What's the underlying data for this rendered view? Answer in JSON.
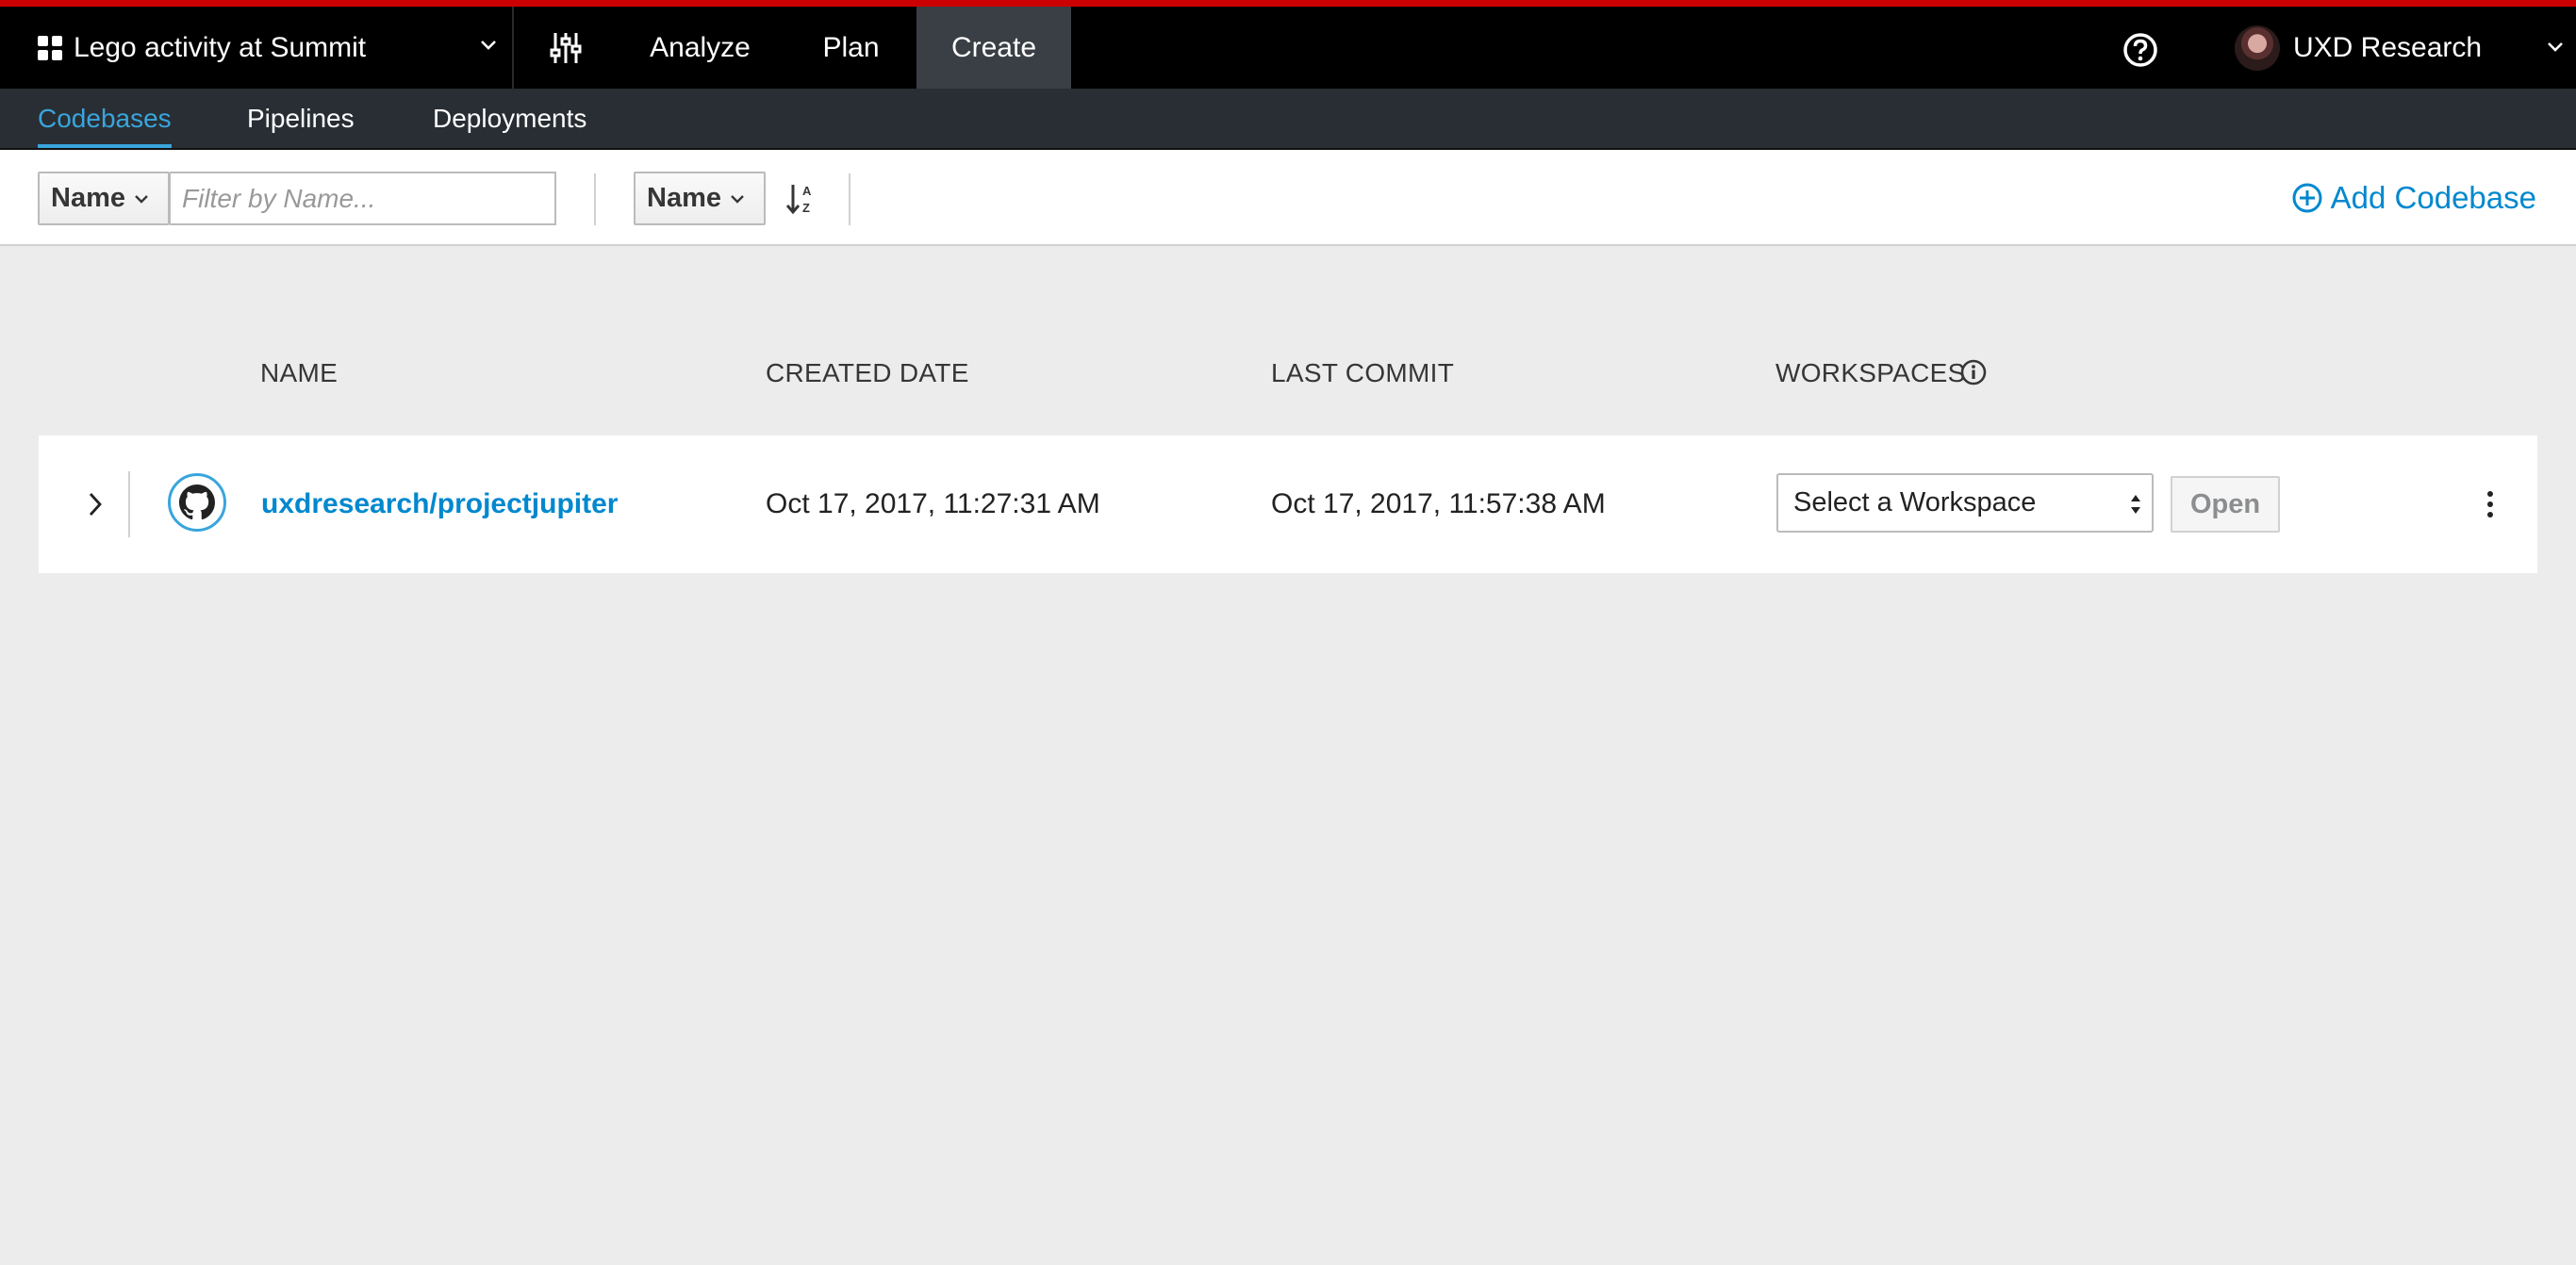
{
  "topbar": {
    "space_name": "Lego activity at Summit",
    "tabs": [
      {
        "label": "Analyze"
      },
      {
        "label": "Plan"
      },
      {
        "label": "Create",
        "active": true
      }
    ],
    "user_name": "UXD Research"
  },
  "subnav": {
    "tabs": [
      {
        "label": "Codebases",
        "active": true
      },
      {
        "label": "Pipelines"
      },
      {
        "label": "Deployments"
      }
    ]
  },
  "toolbar": {
    "filter_field": "Name",
    "filter_placeholder": "Filter by Name...",
    "sort_field": "Name",
    "add_label": "Add Codebase"
  },
  "table": {
    "headers": [
      "NAME",
      "CREATED DATE",
      "LAST COMMIT",
      "WORKSPACES"
    ],
    "rows": [
      {
        "name": "uxdresearch/projectjupiter",
        "created": "Oct 17, 2017, 11:27:31 AM",
        "last_commit": "Oct 17, 2017, 11:57:38 AM",
        "workspace_placeholder": "Select a Workspace",
        "open_label": "Open"
      }
    ]
  },
  "colors": {
    "accent_red": "#cc0000",
    "link_blue": "#0088ce",
    "active_tab_blue": "#39a5dc"
  },
  "icons": [
    "grid-icon",
    "chevron-down-icon",
    "sliders-icon",
    "help-icon",
    "sort-alpha-icon",
    "plus-circle-icon",
    "info-icon",
    "chevron-right-icon",
    "github-icon",
    "kebab-icon"
  ]
}
